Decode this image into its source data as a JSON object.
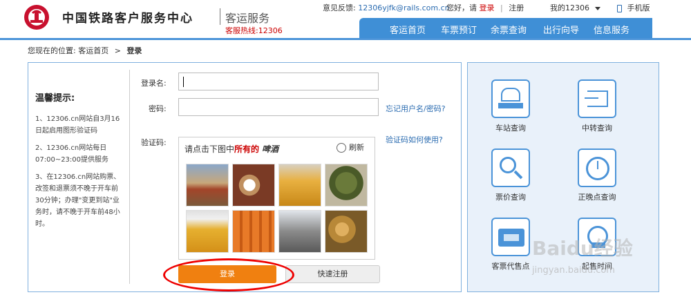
{
  "header": {
    "brand": "中国铁路客户服务中心",
    "service": "客运服务",
    "hotline": "客服热线:12306",
    "feedback_label": "意见反馈:",
    "feedback_email": "12306yjfk@rails.com.cn",
    "greeting": "您好，请",
    "login": "登录",
    "separator": "|",
    "register": "注册",
    "my12306": "我的12306",
    "mobile": "手机版"
  },
  "nav": {
    "items": [
      "客运首页",
      "车票预订",
      "余票查询",
      "出行向导",
      "信息服务"
    ]
  },
  "breadcrumb": {
    "prefix": "您现在的位置:",
    "home": "客运首页",
    "arrow": ">",
    "current": "登录"
  },
  "tips": {
    "title": "温馨提示:",
    "items": [
      "1、12306.cn网站自3月16日起启用图形验证码",
      "2、12306.cn网站每日07:00~23:00提供服务",
      "3、在12306.cn网站购票、改签和退票须不晚于开车前30分钟；办理\"变更到站\"业务时，请不晚于开车前48小时。"
    ]
  },
  "form": {
    "username_label": "登录名:",
    "password_label": "密码:",
    "captcha_label": "验证码:",
    "forgot_link": "忘记用户名/密码?",
    "captcha_help": "验证码如何使用?",
    "captcha_prompt_pre": "请点击下图中",
    "captcha_prompt_red": "所有的",
    "captcha_word": "啤酒",
    "refresh": "刷新",
    "login_button": "登录",
    "register_button": "快速注册",
    "username_value": "",
    "password_value": ""
  },
  "quick": {
    "items": [
      "车站查询",
      "中转查询",
      "票价查询",
      "正晚点查询",
      "客票代售点",
      "起售时间"
    ]
  },
  "watermark": {
    "big": "Baidu经验",
    "small": "jingyan.baidu.com"
  }
}
